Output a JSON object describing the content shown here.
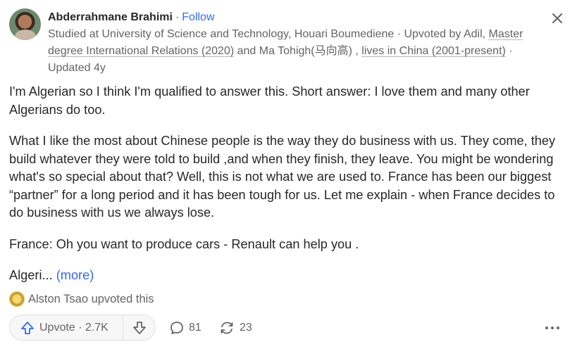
{
  "author": {
    "name": "Abderrahmane Brahimi",
    "follow_label": "Follow",
    "credential_intro": "Studied at University of Science and Technology, Houari Boumediene · Upvoted by Adil, ",
    "credential_link1": "Master degree International Relations (2020)",
    "credential_mid": " and Ma Tohigh(马向高)  , ",
    "credential_link2": "lives in China (2001-present)",
    "credential_updated": " · Updated 4y"
  },
  "answer": {
    "paragraphs": [
      "I'm Algerian so I think I'm qualified to answer this. Short answer: I love them and many other Algerians do too.",
      "What I like the most about Chinese people is the way they do business with us. They come, they build whatever they were told to build ,and when they finish, they leave. You might be wondering what's so special about that? Well, this is not what we are used to. France has been our biggest “partner” for a long period and it has been tough for us. Let me explain - when France decides to do business with us we always lose.",
      "France: Oh you want to produce cars - Renault can help you ."
    ],
    "truncated_text": "Algeri...",
    "more_label": "(more)"
  },
  "upvoted_by": {
    "text": "Alston Tsao upvoted this"
  },
  "actions": {
    "upvote_label": "Upvote",
    "upvote_count": "2.7K",
    "comment_count": "81",
    "share_count": "23"
  },
  "icons": {
    "close": "close-icon",
    "upvote": "upvote-arrow-icon",
    "downvote": "downvote-arrow-icon",
    "comment": "comment-bubble-icon",
    "share": "share-cycle-icon",
    "more": "more-dots-icon"
  },
  "colors": {
    "accent": "#2e69ff",
    "text": "#282829",
    "muted": "#636466"
  }
}
